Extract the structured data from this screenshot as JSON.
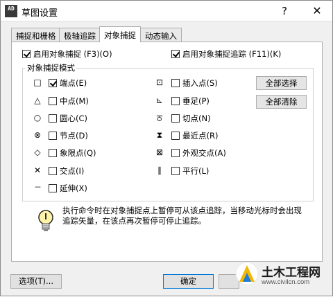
{
  "window": {
    "title": "草图设置",
    "help": "?",
    "close": "✕",
    "app_icon_text": "AD"
  },
  "tabs": [
    {
      "label": "捕捉和栅格",
      "active": false
    },
    {
      "label": "极轴追踪",
      "active": false
    },
    {
      "label": "对象捕捉",
      "active": true
    },
    {
      "label": "动态输入",
      "active": false
    }
  ],
  "panel": {
    "enable_snap": {
      "label": "启用对象捕捉 (F3)(O)",
      "checked": true
    },
    "enable_tracking": {
      "label": "启用对象捕捉追踪 (F11)(K)",
      "checked": true
    },
    "group_title": "对象捕捉模式",
    "left_modes": [
      {
        "symbol": "□",
        "label": "端点(E)",
        "checked": true
      },
      {
        "symbol": "△",
        "label": "中点(M)",
        "checked": false
      },
      {
        "symbol": "○",
        "label": "圆心(C)",
        "checked": false
      },
      {
        "symbol": "⊗",
        "label": "节点(D)",
        "checked": false
      },
      {
        "symbol": "◇",
        "label": "象限点(Q)",
        "checked": false
      },
      {
        "symbol": "✕",
        "label": "交点(I)",
        "checked": false
      },
      {
        "symbol": "---",
        "label": "延伸(X)",
        "checked": false
      }
    ],
    "right_modes": [
      {
        "symbol": "⊡",
        "label": "插入点(S)",
        "checked": false
      },
      {
        "symbol": "⊾",
        "label": "垂足(P)",
        "checked": false
      },
      {
        "symbol": "ਠ",
        "label": "切点(N)",
        "checked": false
      },
      {
        "symbol": "⧗",
        "label": "最近点(R)",
        "checked": false
      },
      {
        "symbol": "⊠",
        "label": "外观交点(A)",
        "checked": false
      },
      {
        "symbol": "∥",
        "label": "平行(L)",
        "checked": false
      }
    ],
    "select_all": "全部选择",
    "clear_all": "全部清除",
    "info": "执行命令时在对象捕捉点上暂停可从该点追踪，当移动光标时会出现追踪矢量，在该点再次暂停可停止追踪。"
  },
  "footer": {
    "options": "选项(T)...",
    "ok": "确定"
  },
  "watermark": {
    "title": "土木工程网",
    "url": "www.civilcn.com"
  }
}
